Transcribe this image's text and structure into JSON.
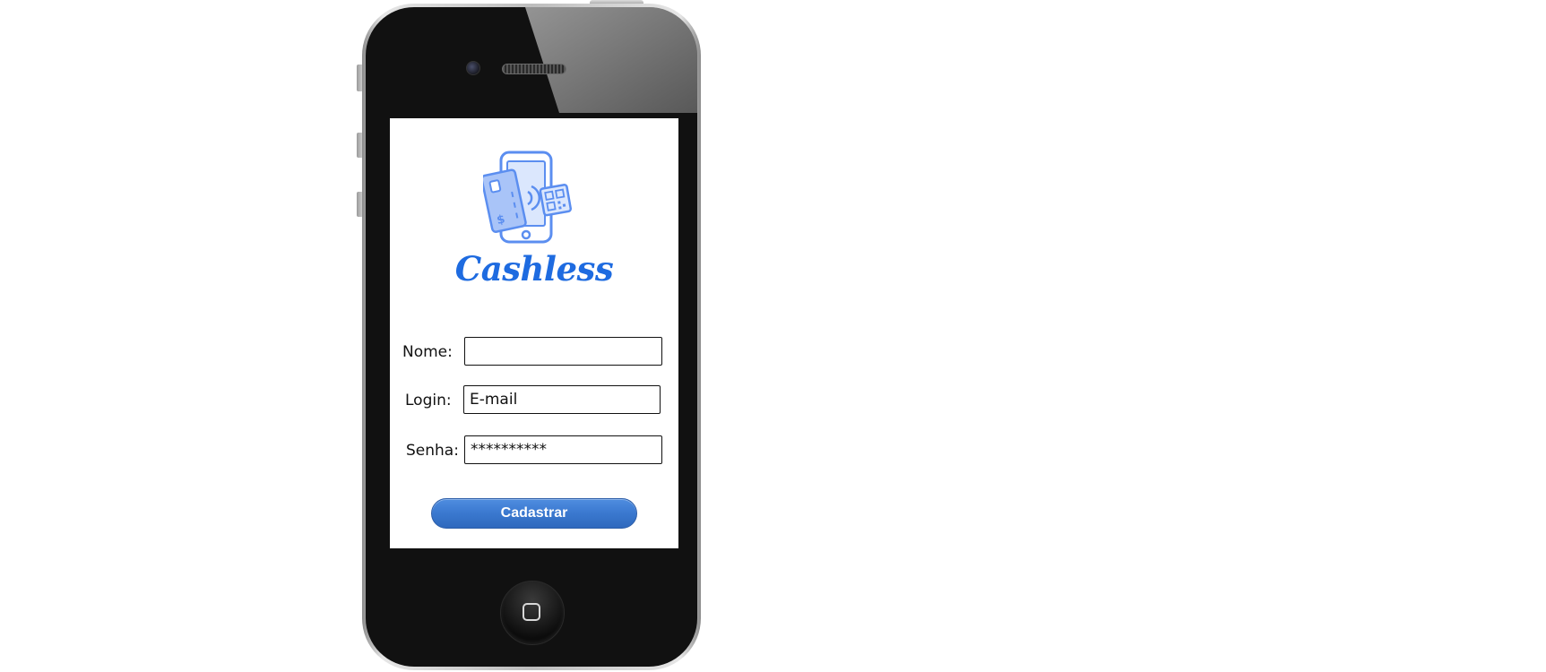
{
  "app": {
    "brand_name": "Cashless",
    "brand_color": "#1e6be0",
    "logo_icon": "mobile-payment-icon"
  },
  "form": {
    "name_label": "Nome:",
    "name_value": "",
    "login_label": "Login:",
    "login_placeholder": "E-mail",
    "password_label": "Senha:",
    "password_value": "**********",
    "submit_label": "Cadastrar"
  },
  "colors": {
    "button": "#3a78cf",
    "screen_background": "#ffffff",
    "device_body": "#111111"
  },
  "device": {
    "home_button_icon": "home-square-icon"
  }
}
